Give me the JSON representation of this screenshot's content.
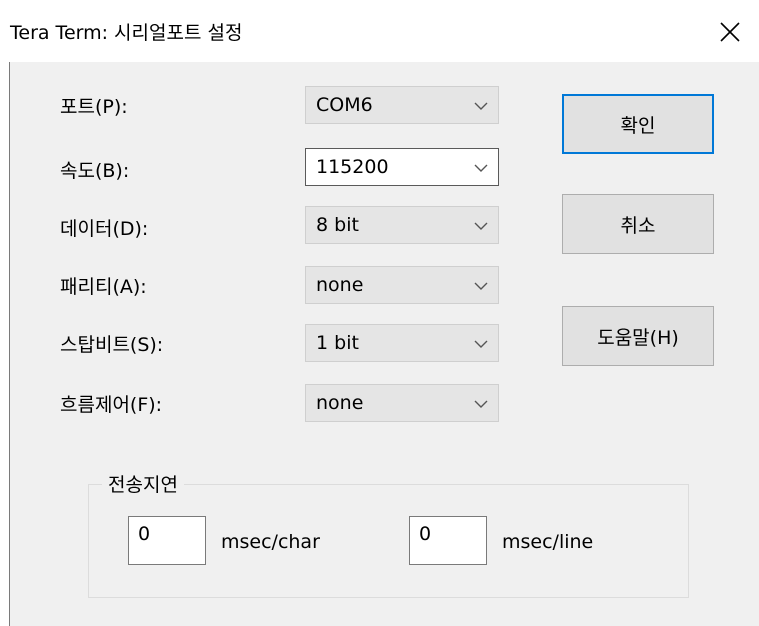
{
  "window": {
    "title": "Tera Term: 시리얼포트 설정"
  },
  "fields": [
    {
      "label": "포트(P):",
      "value": "COM6"
    },
    {
      "label": "속도(B):",
      "value": "115200"
    },
    {
      "label": "데이터(D):",
      "value": "8 bit"
    },
    {
      "label": "패리티(A):",
      "value": "none"
    },
    {
      "label": "스탑비트(S):",
      "value": "1 bit"
    },
    {
      "label": "흐름제어(F):",
      "value": "none"
    }
  ],
  "buttons": {
    "ok": "확인",
    "cancel": "취소",
    "help": "도움말(H)"
  },
  "delay_group": {
    "title": "전송지연",
    "char_value": "0",
    "char_unit": "msec/char",
    "line_value": "0",
    "line_unit": "msec/line"
  },
  "colors": {
    "default_button_border": "#0078d7",
    "client_background": "#f0f0f0"
  },
  "icons": {
    "close": "close-icon",
    "dropdown": "chevron-down-icon"
  }
}
